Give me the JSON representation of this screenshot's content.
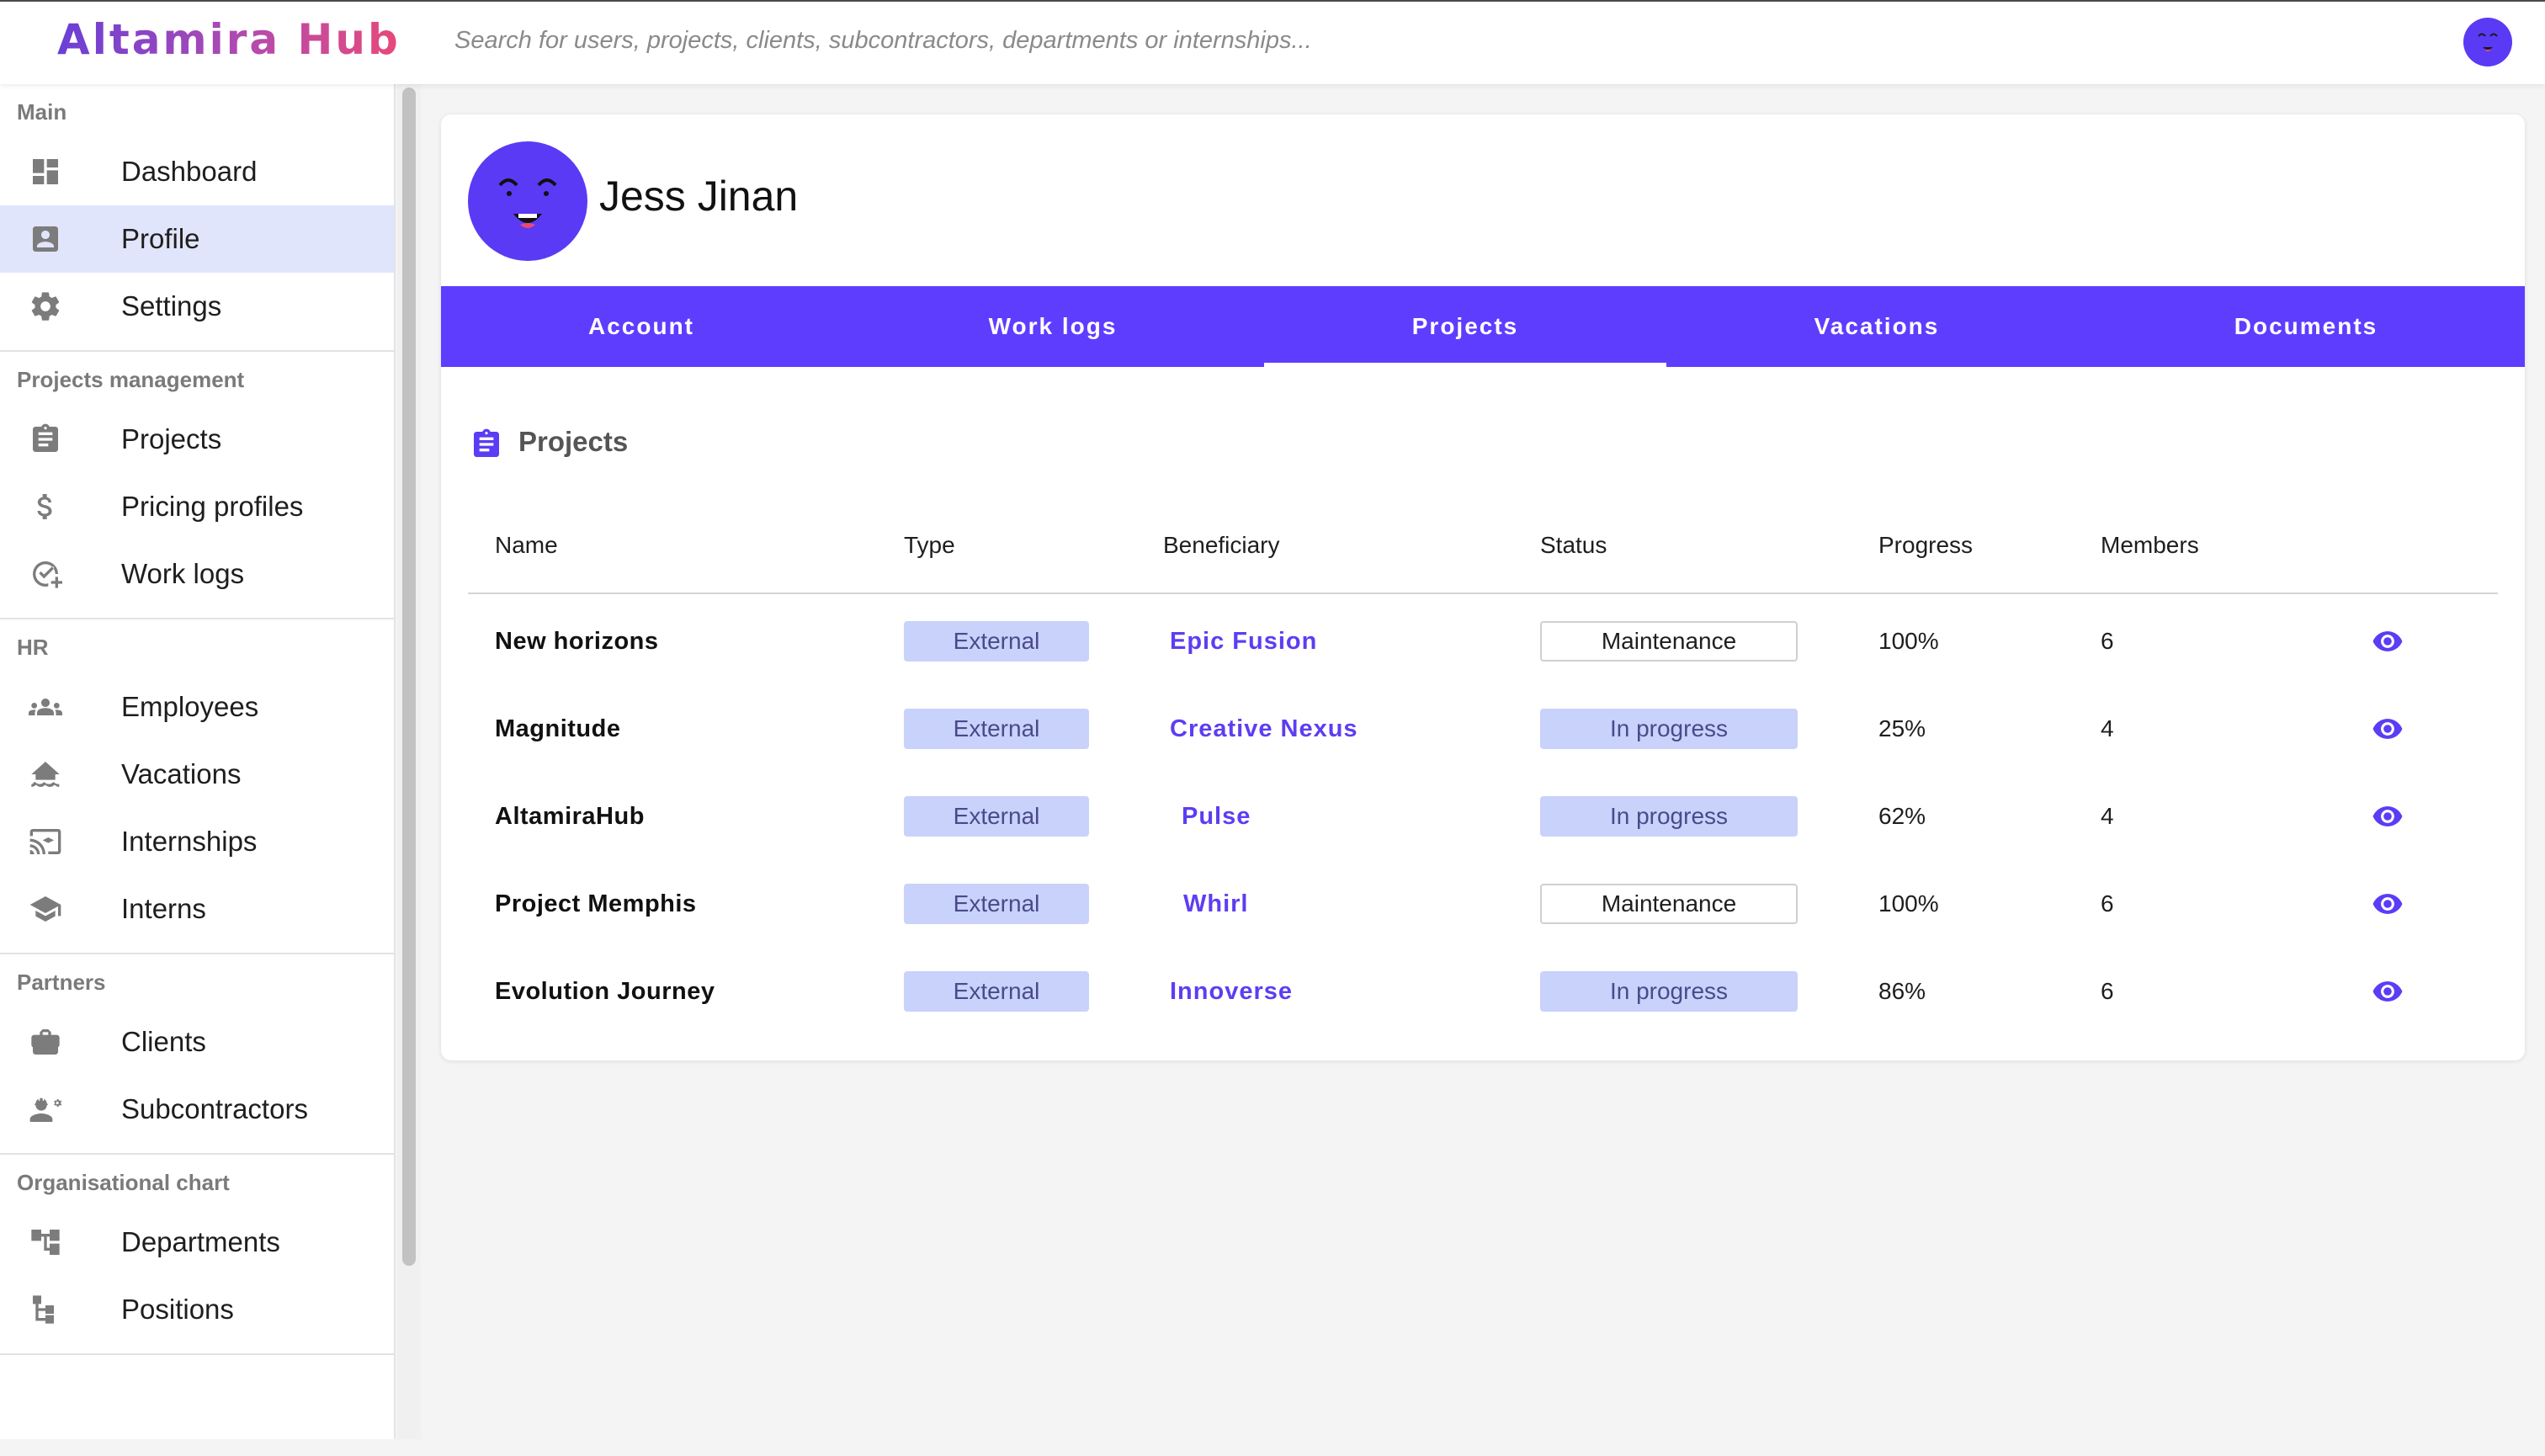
{
  "app": {
    "logo": "Altamira Hub"
  },
  "search": {
    "placeholder": "Search for users, projects, clients, subcontractors, departments or internships..."
  },
  "sidebar": {
    "sections": [
      {
        "title": "Main",
        "items": [
          {
            "label": "Dashboard",
            "icon": "dashboard-icon"
          },
          {
            "label": "Profile",
            "icon": "profile-icon",
            "active": true
          },
          {
            "label": "Settings",
            "icon": "gear-icon"
          }
        ]
      },
      {
        "title": "Projects management",
        "items": [
          {
            "label": "Projects",
            "icon": "clipboard-icon"
          },
          {
            "label": "Pricing profiles",
            "icon": "dollar-icon"
          },
          {
            "label": "Work logs",
            "icon": "check-add-icon"
          }
        ]
      },
      {
        "title": "HR",
        "items": [
          {
            "label": "Employees",
            "icon": "group-icon"
          },
          {
            "label": "Vacations",
            "icon": "beach-icon"
          },
          {
            "label": "Internships",
            "icon": "cast-icon"
          },
          {
            "label": "Interns",
            "icon": "school-icon"
          }
        ]
      },
      {
        "title": "Partners",
        "items": [
          {
            "label": "Clients",
            "icon": "briefcase-icon"
          },
          {
            "label": "Subcontractors",
            "icon": "engineer-icon"
          }
        ]
      },
      {
        "title": "Organisational chart",
        "items": [
          {
            "label": "Departments",
            "icon": "tree-icon"
          },
          {
            "label": "Positions",
            "icon": "hierarchy-icon"
          }
        ]
      }
    ]
  },
  "profile": {
    "name": "Jess Jinan"
  },
  "tabs": [
    {
      "label": "Account"
    },
    {
      "label": "Work logs"
    },
    {
      "label": "Projects",
      "active": true
    },
    {
      "label": "Vacations"
    },
    {
      "label": "Documents"
    }
  ],
  "projects": {
    "heading": "Projects",
    "columns": [
      "Name",
      "Type",
      "Beneficiary",
      "Status",
      "Progress",
      "Members"
    ],
    "rows": [
      {
        "name": "New horizons",
        "type": "External",
        "beneficiary": "Epic Fusion",
        "status": "Maintenance",
        "progress": "100%",
        "members": "6"
      },
      {
        "name": "Magnitude",
        "type": "External",
        "beneficiary": "Creative Nexus",
        "status": "In progress",
        "progress": "25%",
        "members": "4"
      },
      {
        "name": "AltamiraHub",
        "type": "External",
        "beneficiary": "Pulse",
        "status": "In progress",
        "progress": "62%",
        "members": "4"
      },
      {
        "name": "Project Memphis",
        "type": "External",
        "beneficiary": "Whirl",
        "status": "Maintenance",
        "progress": "100%",
        "members": "6"
      },
      {
        "name": "Evolution Journey",
        "type": "External",
        "beneficiary": "Innoverse",
        "status": "In progress",
        "progress": "86%",
        "members": "6"
      }
    ]
  },
  "colors": {
    "accent": "#5f3dff",
    "pill": "#c8d2fb",
    "active_nav": "#e1e5fb",
    "link": "#5e3df2"
  }
}
